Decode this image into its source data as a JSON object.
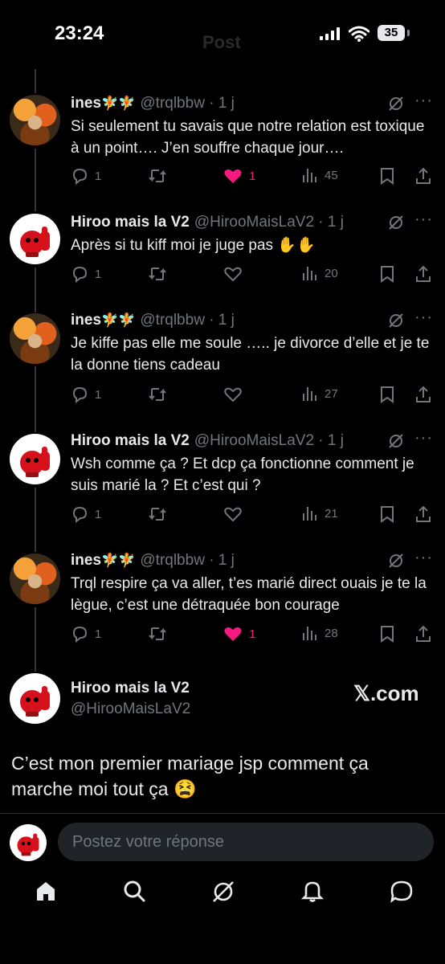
{
  "status_bar": {
    "time": "23:24",
    "header_title": "Post",
    "battery": "35"
  },
  "tweets": [
    {
      "name": "ines",
      "emoji": "🧚🧚",
      "handle": "@trqlbbw · 1 j",
      "text": "Si seulement tu savais que notre relation est toxique à un point…. J’en souffre chaque jour….",
      "replies": "1",
      "reposts": "",
      "likes": "1",
      "liked": true,
      "views": "45"
    },
    {
      "name": "Hiroo mais la V2",
      "emoji": "",
      "handle": "@HirooMaisLaV2 · 1 j",
      "text": "Après si tu kiff moi je juge pas ✋✋",
      "replies": "1",
      "reposts": "",
      "likes": "",
      "liked": false,
      "views": "20"
    },
    {
      "name": "ines",
      "emoji": "🧚🧚",
      "handle": "@trqlbbw · 1 j",
      "text": "Je kiffe pas elle me soule ….. je divorce d’elle et je te la donne tiens cadeau",
      "replies": "1",
      "reposts": "",
      "likes": "",
      "liked": false,
      "views": "27"
    },
    {
      "name": "Hiroo mais la V2",
      "emoji": "",
      "handle": "@HirooMaisLaV2 · 1 j",
      "text": "Wsh comme ça ? Et dcp ça fonctionne comment je suis marié la ? Et c’est qui ?",
      "replies": "1",
      "reposts": "",
      "likes": "",
      "liked": false,
      "views": "21"
    },
    {
      "name": "ines",
      "emoji": "🧚🧚",
      "handle": "@trqlbbw · 1 j",
      "text": "Trql respire ça va aller, t’es marié direct ouais je te la lègue, c’est une détraquée bon courage",
      "replies": "1",
      "reposts": "",
      "likes": "1",
      "liked": true,
      "views": "28"
    }
  ],
  "main_post": {
    "name": "Hiroo mais la V2",
    "handle": "@HirooMaisLaV2",
    "brand": "𝕏.com",
    "text": "C’est mon premier mariage jsp comment ça marche moi tout ça 😫"
  },
  "reply": {
    "placeholder": "Postez votre réponse"
  },
  "tabbar": [
    "home-icon",
    "search-icon",
    "grok-icon",
    "notifications-icon",
    "messages-icon"
  ],
  "colors": {
    "background": "#000000",
    "text": "#e7e9ea",
    "muted": "#71767b",
    "like": "#f91880"
  }
}
